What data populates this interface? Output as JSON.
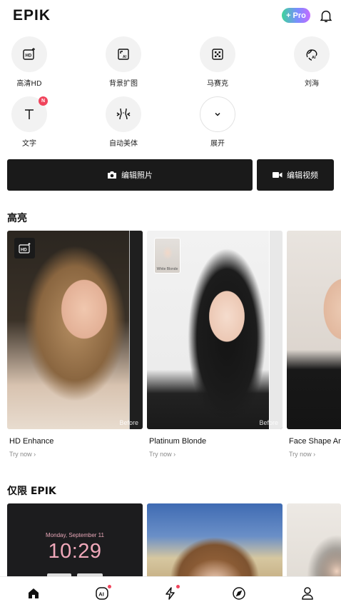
{
  "header": {
    "logo": "EPIK",
    "pro_label": "+ Pro"
  },
  "tools": [
    {
      "label": "高清HD",
      "icon": "hd-enhance-icon"
    },
    {
      "label": "背景扩图",
      "icon": "ai-expand-icon"
    },
    {
      "label": "马赛克",
      "icon": "mosaic-icon"
    },
    {
      "label": "刘海",
      "icon": "ai-bangs-icon"
    },
    {
      "label": "文字",
      "icon": "text-icon",
      "badge": "N"
    },
    {
      "label": "自动美体",
      "icon": "body-reshape-icon"
    },
    {
      "label": "展开",
      "icon": "chevron-down-icon"
    }
  ],
  "actions": {
    "edit_photo": "编辑照片",
    "edit_video": "编辑视频"
  },
  "sections": {
    "highlights": "高亮",
    "epik_only": "仅限 EPIK"
  },
  "cards": [
    {
      "title": "HD Enhance",
      "try": "Try now ›",
      "before": "Before"
    },
    {
      "title": "Platinum Blonde",
      "try": "Try now ›",
      "before": "Before",
      "thumb": "White Blonde"
    },
    {
      "title": "Face Shape An",
      "try": "Try now ›"
    }
  ],
  "lockscreen": {
    "date": "Monday, September 11",
    "time": "10:29"
  },
  "tabbar": [
    {
      "name": "home-icon",
      "active": true
    },
    {
      "name": "ai-icon",
      "dot": true
    },
    {
      "name": "lightning-icon",
      "dot": true
    },
    {
      "name": "compass-icon"
    },
    {
      "name": "profile-icon"
    }
  ],
  "colors": {
    "accent_red": "#f0445c",
    "dark_button": "#1a1a1a",
    "pro_gradient_start": "#3ed49a",
    "pro_gradient_end": "#c46bff"
  }
}
